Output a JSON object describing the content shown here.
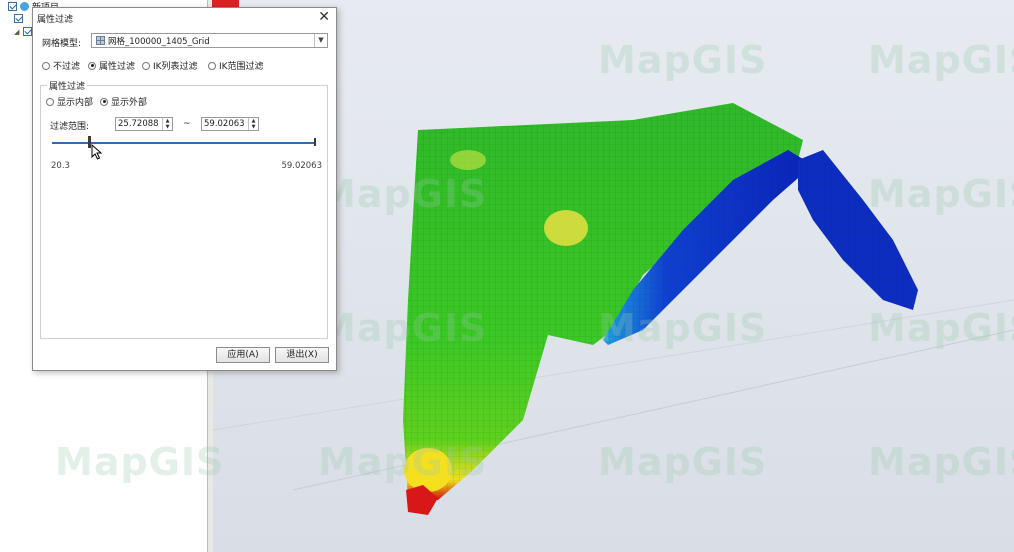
{
  "tree": {
    "items": [
      {
        "label": "新项目",
        "checked": true
      },
      {
        "label": "",
        "checked": true
      },
      {
        "label": "",
        "checked": true
      }
    ]
  },
  "dialog": {
    "title": "属性过滤",
    "model_label": "网格模型:",
    "model_value": "网格_100000_1405_Grid",
    "filter_modes": [
      {
        "label": "不过滤",
        "selected": false
      },
      {
        "label": "属性过滤",
        "selected": true
      },
      {
        "label": "IK列表过滤",
        "selected": false
      },
      {
        "label": "IK范围过滤",
        "selected": false
      }
    ],
    "group_title": "属性过滤",
    "display_modes": [
      {
        "label": "显示内部",
        "selected": false
      },
      {
        "label": "显示外部",
        "selected": true
      }
    ],
    "range_label": "过滤范围:",
    "range_from": "25.72088",
    "range_to": "59.02063",
    "range_separator": "~",
    "slider_min_label": "20.3",
    "slider_max_label": "59.02063",
    "slider_value_fraction": 0.14,
    "apply_label": "应用(A)",
    "exit_label": "退出(X)"
  },
  "watermark": "MapGIS",
  "colors": {
    "accent": "#2d6db6",
    "low": "#1030d0",
    "mid": "#30c020",
    "high": "#e01010"
  }
}
